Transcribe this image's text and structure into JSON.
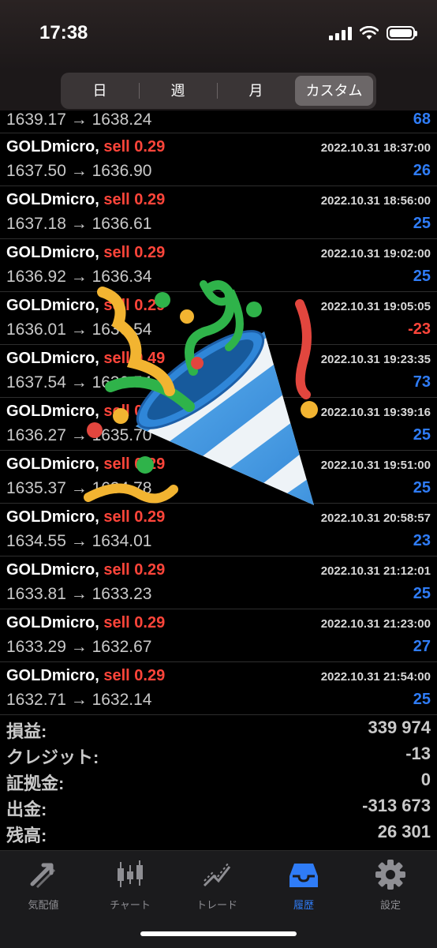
{
  "status": {
    "time": "17:38"
  },
  "period_tabs": [
    "日",
    "週",
    "月",
    "カスタム"
  ],
  "active_tab": "カスタム",
  "first_row": {
    "prices": "1639.17 → 1638.24",
    "profit": "68"
  },
  "trades": [
    {
      "symbol": "GOLDmicro,",
      "type": "sell 0.29",
      "datetime": "2022.10.31 18:37:00",
      "prices": "1637.50 → 1636.90",
      "profit": "26"
    },
    {
      "symbol": "GOLDmicro,",
      "type": "sell 0.29",
      "datetime": "2022.10.31 18:56:00",
      "prices": "1637.18 → 1636.61",
      "profit": "25"
    },
    {
      "symbol": "GOLDmicro,",
      "type": "sell 0.29",
      "datetime": "2022.10.31 19:02:00",
      "prices": "1636.92 → 1636.34",
      "profit": "25"
    },
    {
      "symbol": "GOLDmicro,",
      "type": "sell 0.29",
      "datetime": "2022.10.31 19:05:05",
      "prices": "1636.01 → 1636.54",
      "profit": "-23"
    },
    {
      "symbol": "GOLDmicro,",
      "type": "sell 0.49",
      "datetime": "2022.10.31 19:23:35",
      "prices": "1637.54 → 1636.54",
      "profit": "73"
    },
    {
      "symbol": "GOLDmicro,",
      "type": "sell 0.29",
      "datetime": "2022.10.31 19:39:16",
      "prices": "1636.27 → 1635.70",
      "profit": "25"
    },
    {
      "symbol": "GOLDmicro,",
      "type": "sell 0.29",
      "datetime": "2022.10.31 19:51:00",
      "prices": "1635.37 → 1634.78",
      "profit": "25"
    },
    {
      "symbol": "GOLDmicro,",
      "type": "sell 0.29",
      "datetime": "2022.10.31 20:58:57",
      "prices": "1634.55 → 1634.01",
      "profit": "23"
    },
    {
      "symbol": "GOLDmicro,",
      "type": "sell 0.29",
      "datetime": "2022.10.31 21:12:01",
      "prices": "1633.81 → 1633.23",
      "profit": "25"
    },
    {
      "symbol": "GOLDmicro,",
      "type": "sell 0.29",
      "datetime": "2022.10.31 21:23:00",
      "prices": "1633.29 → 1632.67",
      "profit": "27"
    },
    {
      "symbol": "GOLDmicro,",
      "type": "sell 0.29",
      "datetime": "2022.10.31 21:54:00",
      "prices": "1632.71 → 1632.14",
      "profit": "25"
    }
  ],
  "summary": [
    {
      "label": "損益:",
      "value": "339 974"
    },
    {
      "label": "クレジット:",
      "value": "-13"
    },
    {
      "label": "証拠金:",
      "value": "0"
    },
    {
      "label": "出金:",
      "value": "-313 673"
    },
    {
      "label": "残高:",
      "value": "26 301"
    }
  ],
  "tabbar": [
    {
      "label": "気配値",
      "icon": "quotes-arrows-icon"
    },
    {
      "label": "チャート",
      "icon": "candlestick-chart-icon"
    },
    {
      "label": "トレード",
      "icon": "trade-line-icon"
    },
    {
      "label": "履歴",
      "icon": "history-inbox-icon"
    },
    {
      "label": "設定",
      "icon": "gear-icon"
    }
  ],
  "active_tabbar": "履歴",
  "colors": {
    "profit_positive": "#2f7cf6",
    "profit_negative": "#ff453a",
    "sell": "#ff453a",
    "active_tab": "#2f7cf6"
  },
  "overlay": {
    "icon": "party-popper-icon"
  }
}
